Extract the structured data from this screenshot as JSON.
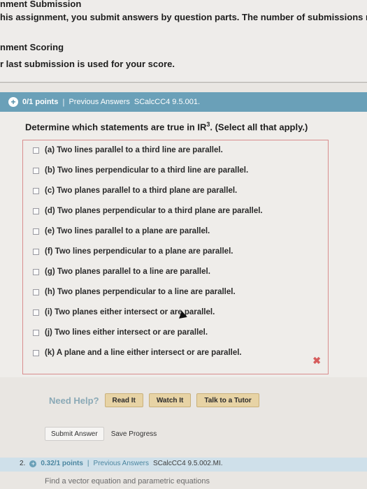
{
  "header": {
    "line1": "nment Submission",
    "line2": "his assignment, you submit answers by question parts. The number of submissions r",
    "line3": "nment Scoring",
    "line4": "r last submission is used for your score."
  },
  "question": {
    "points": "0/1 points",
    "separator": "|",
    "previous_answers": "Previous Answers",
    "code": "SCalcCC4 9.5.001.",
    "prompt_before": "Determine which statements are true in ",
    "prompt_math": "IR",
    "prompt_sup": "3",
    "prompt_after": ". (Select all that apply.)",
    "choices": [
      "(a) Two lines parallel to a third line are parallel.",
      "(b) Two lines perpendicular to a third line are parallel.",
      "(c) Two planes parallel to a third plane are parallel.",
      "(d) Two planes perpendicular to a third plane are parallel.",
      "(e) Two lines parallel to a plane are parallel.",
      "(f) Two lines perpendicular to a plane are parallel.",
      "(g) Two planes parallel to a line are parallel.",
      "(h) Two planes perpendicular to a line are parallel.",
      "(i) Two planes either intersect or are parallel.",
      "(j) Two lines either intersect or are parallel.",
      "(k) A plane and a line either intersect or are parallel."
    ],
    "incorrect_mark": "✖"
  },
  "help": {
    "label": "Need Help?",
    "read": "Read It",
    "watch": "Watch It",
    "tutor": "Talk to a Tutor"
  },
  "actions": {
    "submit": "Submit Answer",
    "save": "Save Progress"
  },
  "next": {
    "number": "2.",
    "points": "0.32/1 points",
    "separator": "|",
    "previous_answers": "Previous Answers",
    "code": "SCalcCC4 9.5.002.MI.",
    "text": "Find a vector equation and parametric equations"
  },
  "colors": {
    "header_bar": "#6aa0b8",
    "incorrect": "#d65c5c",
    "help_button": "#e7d3a5"
  },
  "icons": [
    "plus-circle-icon",
    "close-x-icon",
    "mouse-cursor-icon"
  ]
}
